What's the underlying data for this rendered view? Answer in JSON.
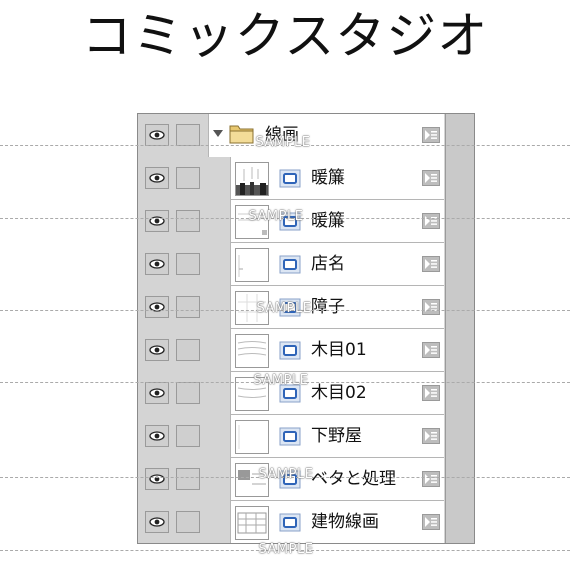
{
  "app_title": "コミックスタジオ",
  "layers_panel": {
    "layers": [
      {
        "kind": "folder",
        "name": "線画",
        "expanded": true
      },
      {
        "kind": "raster",
        "name": "暖簾"
      },
      {
        "kind": "raster",
        "name": "暖簾"
      },
      {
        "kind": "raster",
        "name": "店名"
      },
      {
        "kind": "raster",
        "name": "障子"
      },
      {
        "kind": "raster",
        "name": "木目01"
      },
      {
        "kind": "raster",
        "name": "木目02"
      },
      {
        "kind": "raster",
        "name": "下野屋"
      },
      {
        "kind": "raster",
        "name": "ベタと処理"
      },
      {
        "kind": "raster",
        "name": "建物線画"
      }
    ],
    "icons": {
      "visibility": "eye-icon",
      "lock": "lock-toggle",
      "folder": "folder-icon",
      "layer_type": "raster-layer-icon",
      "properties": "layer-properties-icon",
      "expander": "expand-triangle-icon"
    }
  },
  "watermark": "SAMPLE",
  "colors": {
    "panel_bg": "#d4d4d4",
    "layer_bg": "#ffffff",
    "layer_icon": "#2e64b8",
    "folder_icon": "#e8c870"
  }
}
